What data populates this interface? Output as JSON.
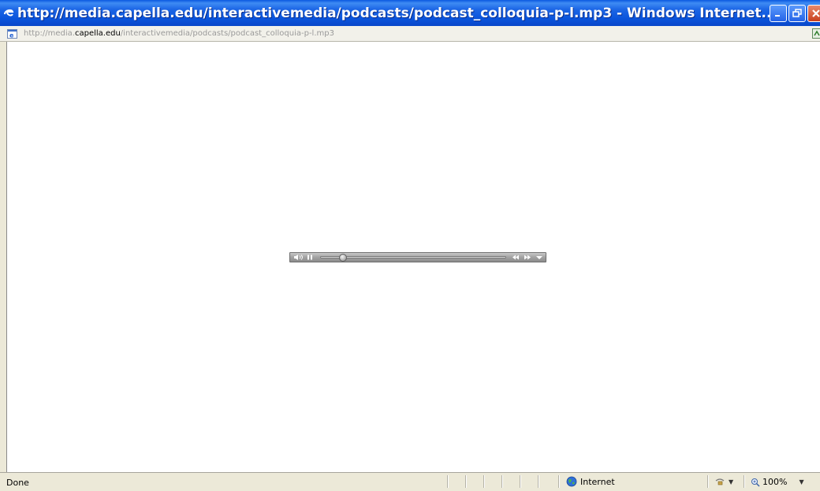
{
  "window": {
    "title": "http://media.capella.edu/interactivemedia/podcasts/podcast_colloquia-p-l.mp3 - Windows Internet...",
    "icon": "ie-logo-icon",
    "controls": [
      "minimize-icon",
      "restore-icon",
      "close-icon"
    ]
  },
  "address": {
    "prefix": "http://media.",
    "domain": "capella.edu",
    "path": "/interactivemedia/podcasts/podcast_colloquia-p-l.mp3"
  },
  "player": {
    "controls": [
      "volume-icon",
      "pause-icon",
      "seek-slider",
      "rewind-icon",
      "fast-forward-icon",
      "menu-dropdown-icon"
    ],
    "progress": 0.1
  },
  "status": {
    "text": "Done",
    "zone": "Internet",
    "zoom": "100%"
  },
  "colors": {
    "titlebar": "#0b55dc",
    "chrome": "#ece9d8"
  }
}
